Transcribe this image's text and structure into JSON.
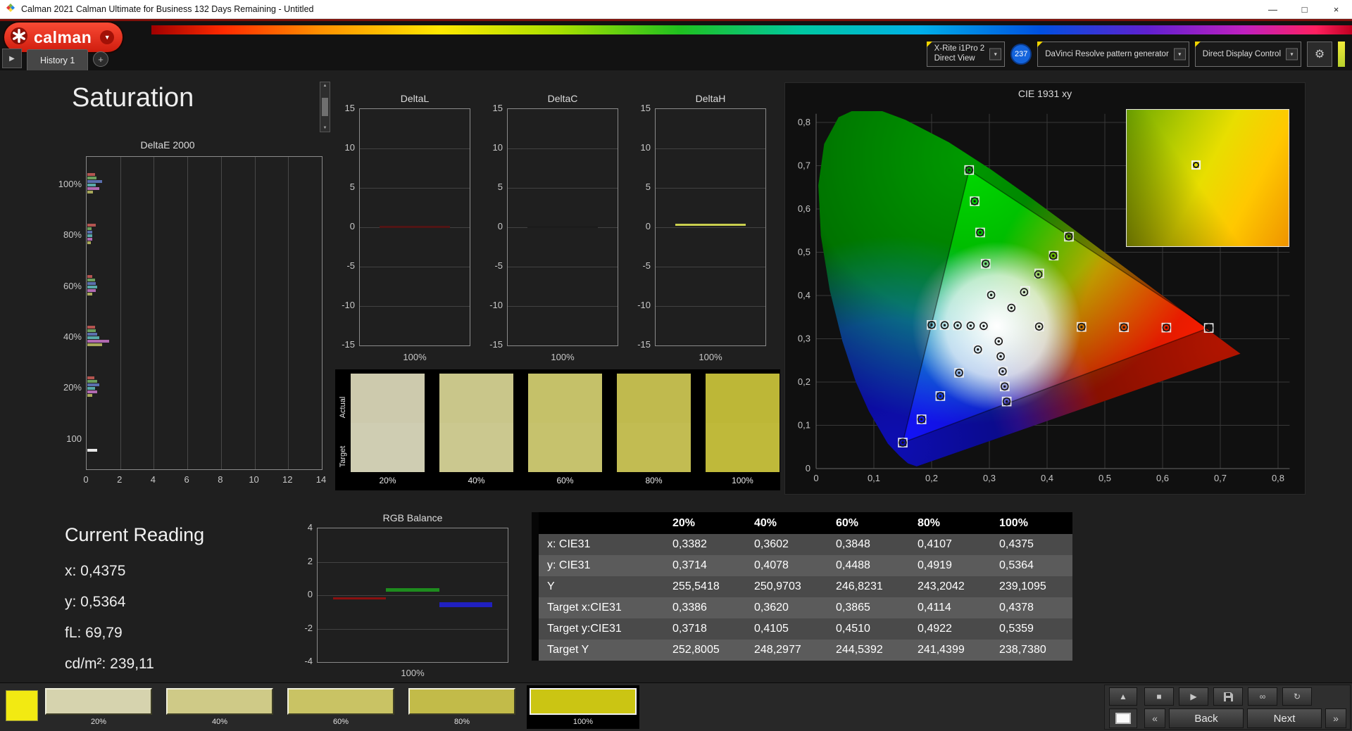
{
  "window": {
    "title": "Calman 2021 Calman Ultimate for Business 132 Days Remaining  - Untitled"
  },
  "icons": {
    "minimize": "—",
    "maximize": "□",
    "close": "×",
    "dropdown": "▾",
    "add_tab": "+",
    "expander": "▶",
    "gear": "⚙",
    "stop": "■",
    "play": "▶",
    "infinity": "∞",
    "loop": "↻",
    "eject": "▲",
    "prev": "«",
    "next_arrow": "»",
    "scroll_up": "▲",
    "scroll_down": "▼",
    "logo_caret": "▼"
  },
  "brand": {
    "logo_text": "calman"
  },
  "tabs": {
    "history": "History 1"
  },
  "header_controls": {
    "meter_line1": "X-Rite i1Pro 2",
    "meter_line2": "Direct View",
    "badge": "237",
    "pattern_generator": "DaVinci Resolve pattern generator",
    "display_control": "Direct Display Control"
  },
  "page": {
    "title": "Saturation"
  },
  "current_reading": {
    "title": "Current Reading",
    "lines": [
      "x: 0,4375",
      "y: 0,5364",
      "fL: 69,79",
      "cd/m²: 239,11"
    ]
  },
  "table": {
    "columns": [
      "",
      "20%",
      "40%",
      "60%",
      "80%",
      "100%"
    ],
    "rows": [
      {
        "label": "x: CIE31",
        "values": [
          "0,3382",
          "0,3602",
          "0,3848",
          "0,4107",
          "0,4375"
        ]
      },
      {
        "label": "y: CIE31",
        "values": [
          "0,3714",
          "0,4078",
          "0,4488",
          "0,4919",
          "0,5364"
        ]
      },
      {
        "label": "Y",
        "values": [
          "255,5418",
          "250,9703",
          "246,8231",
          "243,2042",
          "239,1095"
        ]
      },
      {
        "label": "Target x:CIE31",
        "values": [
          "0,3386",
          "0,3620",
          "0,3865",
          "0,4114",
          "0,4378"
        ]
      },
      {
        "label": "Target y:CIE31",
        "values": [
          "0,3718",
          "0,4105",
          "0,4510",
          "0,4922",
          "0,5359"
        ]
      },
      {
        "label": "Target Y",
        "values": [
          "252,8005",
          "248,2977",
          "244,5392",
          "241,4399",
          "238,7380"
        ]
      }
    ]
  },
  "swatch_panel": {
    "row_labels": [
      "Actual",
      "Target"
    ],
    "steps": [
      {
        "label": "20%",
        "actual": "#cdcaad",
        "target": "#cfcdb2"
      },
      {
        "label": "40%",
        "actual": "#c9c68a",
        "target": "#cbc88f"
      },
      {
        "label": "60%",
        "actual": "#c5c169",
        "target": "#c6c26d"
      },
      {
        "label": "80%",
        "actual": "#c0ba4e",
        "target": "#c2bc52"
      },
      {
        "label": "100%",
        "actual": "#bdb737",
        "target": "#bfb93a"
      }
    ]
  },
  "bottom_bar": {
    "corner_color": "#f2ea12",
    "swatches": [
      {
        "label": "20%",
        "color": "#d6d3ae",
        "selected": false
      },
      {
        "label": "40%",
        "color": "#cfca87",
        "selected": false
      },
      {
        "label": "60%",
        "color": "#c9c364",
        "selected": false
      },
      {
        "label": "80%",
        "color": "#c2bb49",
        "selected": false
      },
      {
        "label": "100%",
        "color": "#cbc513",
        "selected": true
      }
    ],
    "back": "Back",
    "next": "Next"
  },
  "chart_data": [
    {
      "id": "delta_e_2000",
      "type": "bar",
      "orientation": "horizontal",
      "title": "DeltaE 2000",
      "categories": [
        "100%",
        "80%",
        "60%",
        "40%",
        "20%",
        "100"
      ],
      "xlim": [
        0,
        14
      ],
      "xticks": [
        0,
        2,
        4,
        6,
        8,
        10,
        12,
        14
      ],
      "series": [
        {
          "name": "red",
          "color": "#b35450",
          "values": [
            0.45,
            0.5,
            0.3,
            0.45,
            0.4,
            0
          ]
        },
        {
          "name": "green",
          "color": "#6b9e5e",
          "values": [
            0.55,
            0.25,
            0.45,
            0.5,
            0.6,
            0
          ]
        },
        {
          "name": "blue",
          "color": "#5a6fae",
          "values": [
            0.9,
            0.3,
            0.5,
            0.6,
            0.7,
            0
          ]
        },
        {
          "name": "cyan",
          "color": "#58a8a8",
          "values": [
            0.5,
            0.3,
            0.6,
            0.7,
            0.45,
            0
          ]
        },
        {
          "name": "magenta",
          "color": "#b06ab0",
          "values": [
            0.7,
            0.3,
            0.5,
            1.3,
            0.6,
            0
          ]
        },
        {
          "name": "yellow",
          "color": "#a8a85a",
          "values": [
            0.35,
            0.2,
            0.3,
            0.9,
            0.3,
            0
          ]
        },
        {
          "name": "white",
          "color": "#e8e8e8",
          "values": [
            0,
            0,
            0,
            0,
            0,
            0.6
          ]
        }
      ]
    },
    {
      "id": "delta_l",
      "type": "line",
      "title": "DeltaL",
      "ylim": [
        -15,
        15
      ],
      "yticks": [
        15,
        10,
        5,
        0,
        -5,
        -10,
        -15
      ],
      "xlabel": "100%",
      "series": [
        {
          "name": "DeltaL",
          "color": "#521414",
          "values": [
            0.1
          ]
        }
      ]
    },
    {
      "id": "delta_c",
      "type": "line",
      "title": "DeltaC",
      "ylim": [
        -15,
        15
      ],
      "yticks": [
        15,
        10,
        5,
        0,
        -5,
        -10,
        -15
      ],
      "xlabel": "100%",
      "series": [
        {
          "name": "DeltaC",
          "color": "#1c1c1c",
          "values": [
            0.1
          ]
        }
      ]
    },
    {
      "id": "delta_h",
      "type": "line",
      "title": "DeltaH",
      "ylim": [
        -15,
        15
      ],
      "yticks": [
        15,
        10,
        5,
        0,
        -5,
        -10,
        -15
      ],
      "xlabel": "100%",
      "series": [
        {
          "name": "DeltaH",
          "color": "#c9cf4e",
          "values": [
            0.35
          ]
        }
      ]
    },
    {
      "id": "rgb_balance",
      "type": "bar",
      "title": "RGB Balance",
      "ylim": [
        -4,
        4
      ],
      "yticks": [
        4,
        2,
        0,
        -2,
        -4
      ],
      "xlabel": "100%",
      "series": [
        {
          "name": "red",
          "color": "#8a1010",
          "values": [
            -0.2
          ]
        },
        {
          "name": "green",
          "color": "#1e8c1e",
          "values": [
            0.3
          ]
        },
        {
          "name": "blue",
          "color": "#2020c0",
          "values": [
            -0.55
          ]
        }
      ]
    },
    {
      "id": "cie_1931",
      "type": "scatter",
      "title": "CIE 1931 xy",
      "xlim": [
        0,
        0.83
      ],
      "ylim": [
        0,
        0.83
      ],
      "xtick_labels": [
        "0",
        "0,1",
        "0,2",
        "0,3",
        "0,4",
        "0,5",
        "0,6",
        "0,7",
        "0,8"
      ],
      "ytick_labels": [
        "0",
        "0,1",
        "0,2",
        "0,3",
        "0,4",
        "0,5",
        "0,6",
        "0,7",
        "0,8"
      ],
      "white_point": [
        0.3127,
        0.329
      ],
      "gamut_triangle": [
        [
          0.68,
          0.325
        ],
        [
          0.265,
          0.69
        ],
        [
          0.15,
          0.06
        ]
      ],
      "saturation_steps": [
        0.2,
        0.4,
        0.6,
        0.8,
        1.0
      ],
      "sweeps": [
        {
          "name": "red",
          "end": [
            0.68,
            0.325
          ]
        },
        {
          "name": "green",
          "end": [
            0.265,
            0.69
          ]
        },
        {
          "name": "blue",
          "end": [
            0.15,
            0.06
          ]
        },
        {
          "name": "cyan",
          "end": [
            0.2,
            0.332
          ]
        },
        {
          "name": "magenta",
          "end": [
            0.33,
            0.155
          ]
        },
        {
          "name": "yellow",
          "targets_x": [
            0.3386,
            0.362,
            0.3865,
            0.4114,
            0.4378
          ],
          "targets_y": [
            0.3718,
            0.4105,
            0.451,
            0.4922,
            0.5359
          ],
          "points_x": [
            0.3382,
            0.3602,
            0.3848,
            0.4107,
            0.4375
          ],
          "points_y": [
            0.3714,
            0.4078,
            0.4488,
            0.4919,
            0.5364
          ]
        }
      ]
    }
  ]
}
